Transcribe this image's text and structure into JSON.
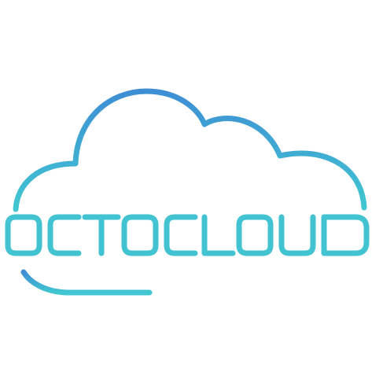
{
  "logo": {
    "wordmark": "OCTOCLOUD",
    "icon": "cloud-outline-icon",
    "colors": {
      "background": "#ffffff",
      "gradient_top": "#3e8ed4",
      "gradient_bottom": "#41c7d1",
      "wordmark": "#41c3d1"
    }
  }
}
